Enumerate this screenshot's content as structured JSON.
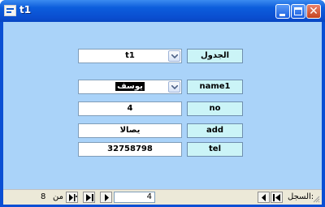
{
  "window": {
    "title": "t1"
  },
  "form": {
    "rows": [
      {
        "label": "الجدول",
        "value": "t1",
        "type": "combo",
        "selected": false
      },
      {
        "label": "name1",
        "value": "يوسف",
        "type": "combo",
        "selected": true
      },
      {
        "label": "no",
        "value": "4",
        "type": "text",
        "selected": false
      },
      {
        "label": "add",
        "value": "يصالا",
        "type": "text",
        "selected": false
      },
      {
        "label": "tel",
        "value": "32758798",
        "type": "text",
        "selected": false
      }
    ]
  },
  "navigator": {
    "record_label": "السجل:",
    "current_record": "4",
    "of_label": "من",
    "total_records": "8"
  },
  "colors": {
    "titlebar": "#0a4ed0",
    "client_background": "#aad3f9",
    "label_background": "#cbf4f7",
    "field_background": "#ffffff"
  },
  "icons": [
    "window-app-icon",
    "minimize-icon",
    "maximize-icon",
    "close-icon",
    "dropdown-arrow-icon",
    "first-record-icon",
    "previous-record-icon",
    "next-record-icon",
    "last-record-icon",
    "new-record-icon",
    "resize-grip-icon"
  ]
}
